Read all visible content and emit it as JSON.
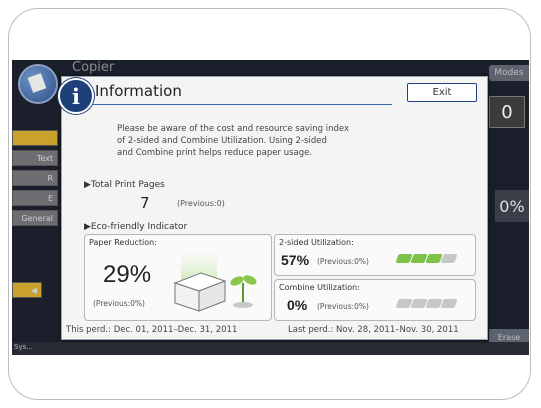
{
  "background": {
    "app_title": "Copier",
    "side_buttons": [
      "",
      "Text",
      "R",
      "E",
      "General"
    ],
    "right_tab": "Modes",
    "counter": "0",
    "percent": "0%",
    "erase_button": "Erase",
    "bottom_label": "Sys..."
  },
  "dialog": {
    "title": "Information",
    "exit_label": "Exit",
    "notice": [
      "Please be aware of the cost and resource saving index",
      "of 2-sided and Combine Utilization. Using 2-sided",
      "and Combine print helps reduce paper usage."
    ],
    "total_label": "▶Total Print Pages",
    "total_value": "7",
    "total_previous": "(Previous:0)",
    "eco_label": "▶Eco-friendly Indicator",
    "paper_reduction": {
      "label": "Paper Reduction:",
      "value": "29%",
      "previous": "(Previous:0%)"
    },
    "two_sided": {
      "label": "2-sided Utilization:",
      "value": "57%",
      "previous": "(Previous:0%)",
      "leaves_filled": 3,
      "leaves_total": 4
    },
    "combine": {
      "label": "Combine Utilization:",
      "value": "0%",
      "previous": "(Previous:0%)",
      "leaves_filled": 0,
      "leaves_total": 4
    },
    "this_period": "This perd.: Dec. 01, 2011–Dec. 31, 2011",
    "last_period": "Last perd.: Nov. 28, 2011–Nov. 30, 2011"
  },
  "colors": {
    "info_icon": "#1d3f7a",
    "leaf_green": "#7fc24a",
    "leaf_gray": "#c8c8c8"
  }
}
